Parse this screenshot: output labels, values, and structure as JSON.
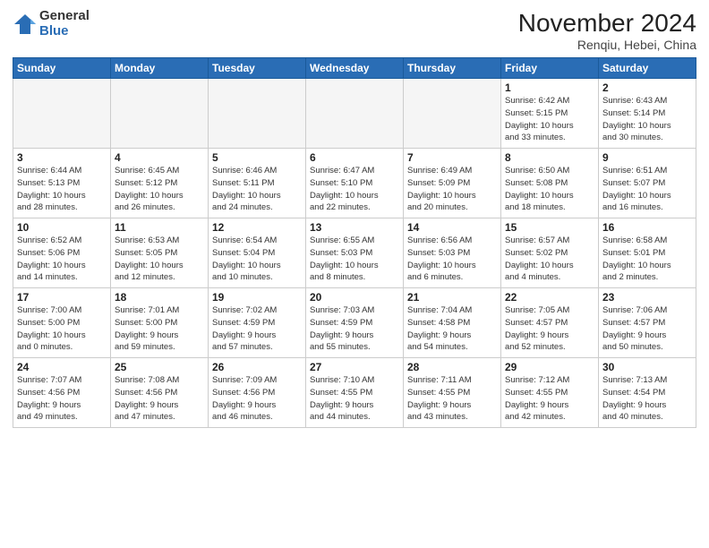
{
  "header": {
    "logo_general": "General",
    "logo_blue": "Blue",
    "month_title": "November 2024",
    "location": "Renqiu, Hebei, China"
  },
  "weekdays": [
    "Sunday",
    "Monday",
    "Tuesday",
    "Wednesday",
    "Thursday",
    "Friday",
    "Saturday"
  ],
  "weeks": [
    [
      {
        "day": "",
        "info": ""
      },
      {
        "day": "",
        "info": ""
      },
      {
        "day": "",
        "info": ""
      },
      {
        "day": "",
        "info": ""
      },
      {
        "day": "",
        "info": ""
      },
      {
        "day": "1",
        "info": "Sunrise: 6:42 AM\nSunset: 5:15 PM\nDaylight: 10 hours\nand 33 minutes."
      },
      {
        "day": "2",
        "info": "Sunrise: 6:43 AM\nSunset: 5:14 PM\nDaylight: 10 hours\nand 30 minutes."
      }
    ],
    [
      {
        "day": "3",
        "info": "Sunrise: 6:44 AM\nSunset: 5:13 PM\nDaylight: 10 hours\nand 28 minutes."
      },
      {
        "day": "4",
        "info": "Sunrise: 6:45 AM\nSunset: 5:12 PM\nDaylight: 10 hours\nand 26 minutes."
      },
      {
        "day": "5",
        "info": "Sunrise: 6:46 AM\nSunset: 5:11 PM\nDaylight: 10 hours\nand 24 minutes."
      },
      {
        "day": "6",
        "info": "Sunrise: 6:47 AM\nSunset: 5:10 PM\nDaylight: 10 hours\nand 22 minutes."
      },
      {
        "day": "7",
        "info": "Sunrise: 6:49 AM\nSunset: 5:09 PM\nDaylight: 10 hours\nand 20 minutes."
      },
      {
        "day": "8",
        "info": "Sunrise: 6:50 AM\nSunset: 5:08 PM\nDaylight: 10 hours\nand 18 minutes."
      },
      {
        "day": "9",
        "info": "Sunrise: 6:51 AM\nSunset: 5:07 PM\nDaylight: 10 hours\nand 16 minutes."
      }
    ],
    [
      {
        "day": "10",
        "info": "Sunrise: 6:52 AM\nSunset: 5:06 PM\nDaylight: 10 hours\nand 14 minutes."
      },
      {
        "day": "11",
        "info": "Sunrise: 6:53 AM\nSunset: 5:05 PM\nDaylight: 10 hours\nand 12 minutes."
      },
      {
        "day": "12",
        "info": "Sunrise: 6:54 AM\nSunset: 5:04 PM\nDaylight: 10 hours\nand 10 minutes."
      },
      {
        "day": "13",
        "info": "Sunrise: 6:55 AM\nSunset: 5:03 PM\nDaylight: 10 hours\nand 8 minutes."
      },
      {
        "day": "14",
        "info": "Sunrise: 6:56 AM\nSunset: 5:03 PM\nDaylight: 10 hours\nand 6 minutes."
      },
      {
        "day": "15",
        "info": "Sunrise: 6:57 AM\nSunset: 5:02 PM\nDaylight: 10 hours\nand 4 minutes."
      },
      {
        "day": "16",
        "info": "Sunrise: 6:58 AM\nSunset: 5:01 PM\nDaylight: 10 hours\nand 2 minutes."
      }
    ],
    [
      {
        "day": "17",
        "info": "Sunrise: 7:00 AM\nSunset: 5:00 PM\nDaylight: 10 hours\nand 0 minutes."
      },
      {
        "day": "18",
        "info": "Sunrise: 7:01 AM\nSunset: 5:00 PM\nDaylight: 9 hours\nand 59 minutes."
      },
      {
        "day": "19",
        "info": "Sunrise: 7:02 AM\nSunset: 4:59 PM\nDaylight: 9 hours\nand 57 minutes."
      },
      {
        "day": "20",
        "info": "Sunrise: 7:03 AM\nSunset: 4:59 PM\nDaylight: 9 hours\nand 55 minutes."
      },
      {
        "day": "21",
        "info": "Sunrise: 7:04 AM\nSunset: 4:58 PM\nDaylight: 9 hours\nand 54 minutes."
      },
      {
        "day": "22",
        "info": "Sunrise: 7:05 AM\nSunset: 4:57 PM\nDaylight: 9 hours\nand 52 minutes."
      },
      {
        "day": "23",
        "info": "Sunrise: 7:06 AM\nSunset: 4:57 PM\nDaylight: 9 hours\nand 50 minutes."
      }
    ],
    [
      {
        "day": "24",
        "info": "Sunrise: 7:07 AM\nSunset: 4:56 PM\nDaylight: 9 hours\nand 49 minutes."
      },
      {
        "day": "25",
        "info": "Sunrise: 7:08 AM\nSunset: 4:56 PM\nDaylight: 9 hours\nand 47 minutes."
      },
      {
        "day": "26",
        "info": "Sunrise: 7:09 AM\nSunset: 4:56 PM\nDaylight: 9 hours\nand 46 minutes."
      },
      {
        "day": "27",
        "info": "Sunrise: 7:10 AM\nSunset: 4:55 PM\nDaylight: 9 hours\nand 44 minutes."
      },
      {
        "day": "28",
        "info": "Sunrise: 7:11 AM\nSunset: 4:55 PM\nDaylight: 9 hours\nand 43 minutes."
      },
      {
        "day": "29",
        "info": "Sunrise: 7:12 AM\nSunset: 4:55 PM\nDaylight: 9 hours\nand 42 minutes."
      },
      {
        "day": "30",
        "info": "Sunrise: 7:13 AM\nSunset: 4:54 PM\nDaylight: 9 hours\nand 40 minutes."
      }
    ]
  ]
}
